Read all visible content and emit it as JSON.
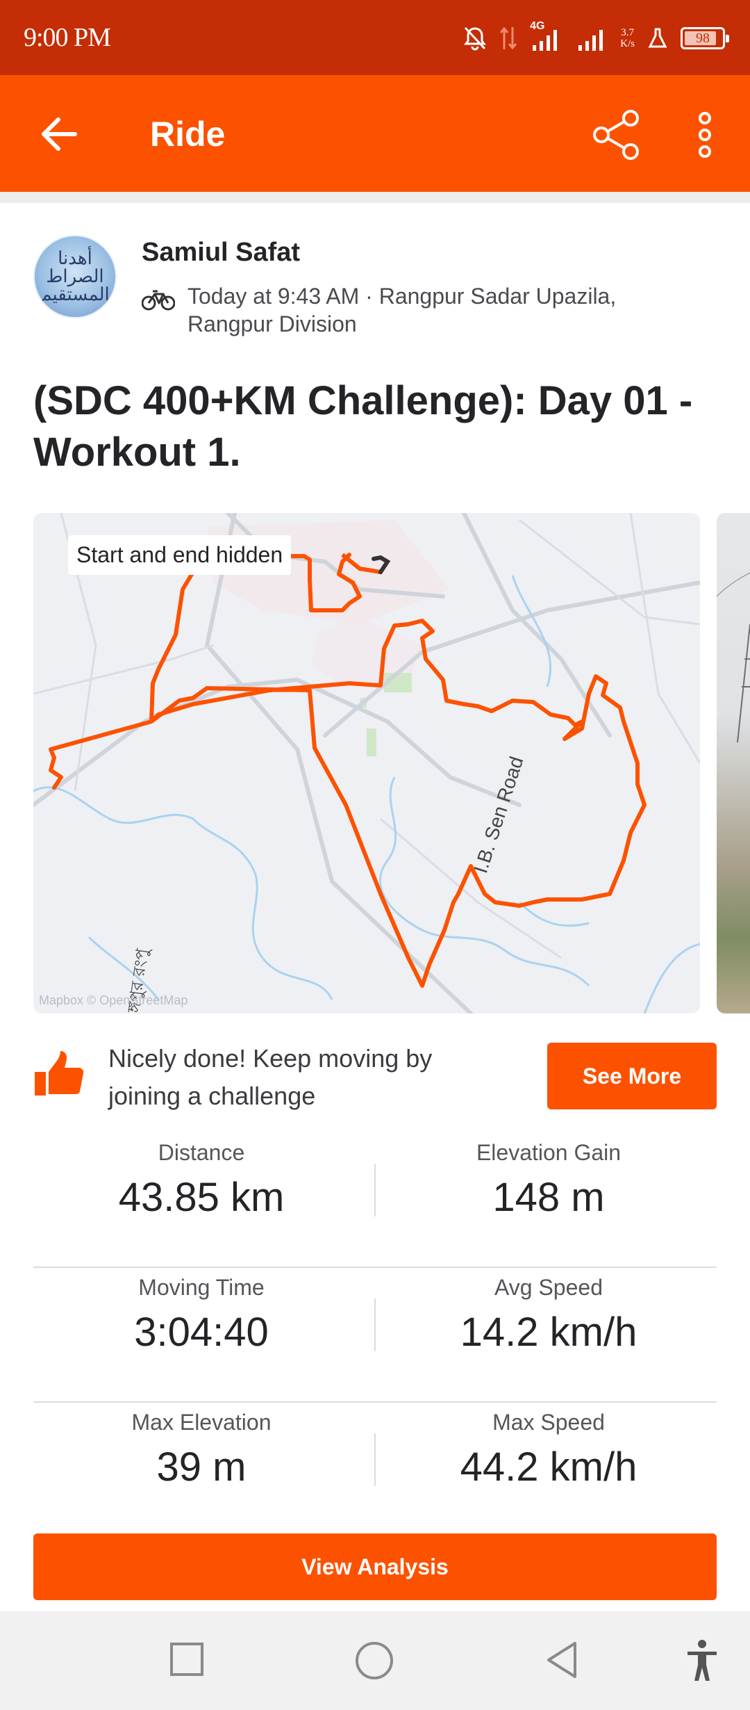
{
  "status_bar": {
    "time": "9:00 PM",
    "network": "4G",
    "speed_value": "3.7",
    "speed_unit": "K/s",
    "battery": "98",
    "icons": [
      "bell-muted-icon",
      "data-arrows-icon",
      "signal-icon",
      "signal-icon",
      "flask-icon",
      "battery-icon"
    ]
  },
  "header": {
    "title": "Ride",
    "back_icon": "back-arrow-icon",
    "share_icon": "share-icon",
    "more_icon": "more-vertical-icon"
  },
  "activity": {
    "athlete_name": "Samiul Safat",
    "avatar_text": "أهدنا الصراط المستقيم",
    "meta_line1": "Today at 9:43 AM · Rangpur Sadar Upazila,",
    "meta_line2": "Rangpur Division",
    "sport_icon": "bicycle-icon",
    "title": "(SDC 400+KM Challenge):  Day 01 - Workout 1."
  },
  "map": {
    "badge": "Start and end hidden",
    "credit": "Mapbox © OpenStreetMap",
    "road_label_1": "I.B. Sen Road",
    "road_label_2": "ঙ্গপুর রংপু",
    "route_color": "#fc5200"
  },
  "challenge_prompt": {
    "text_line1": "Nicely done! Keep moving by",
    "text_line2": "joining a challenge",
    "button": "See More",
    "icon": "thumbs-up-icon"
  },
  "stats": [
    {
      "left_label": "Distance",
      "left_value": "43.85 km",
      "right_label": "Elevation Gain",
      "right_value": "148 m"
    },
    {
      "left_label": "Moving Time",
      "left_value": "3:04:40",
      "right_label": "Avg Speed",
      "right_value": "14.2 km/h"
    },
    {
      "left_label": "Max Elevation",
      "left_value": "39 m",
      "right_label": "Max Speed",
      "right_value": "44.2 km/h"
    }
  ],
  "actions": {
    "view_analysis": "View Analysis"
  },
  "nav_bar": {
    "icons": [
      "recents-square-icon",
      "home-circle-icon",
      "back-triangle-icon",
      "accessibility-icon"
    ]
  },
  "colors": {
    "accent": "#fc5200",
    "status_bar": "#c42d05"
  }
}
